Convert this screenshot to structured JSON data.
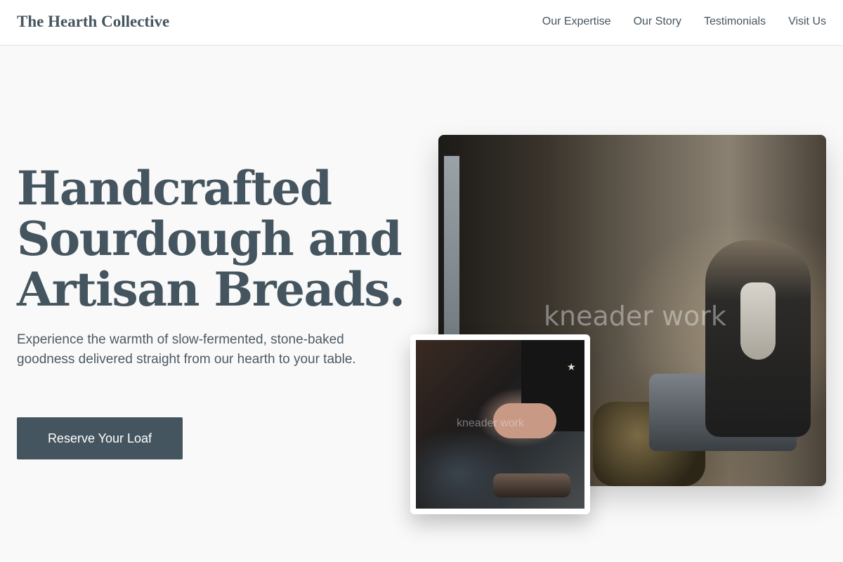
{
  "header": {
    "brand": "The Hearth Collective",
    "nav": [
      "Our Expertise",
      "Our Story",
      "Testimonials",
      "Visit Us"
    ]
  },
  "hero": {
    "headline_lines": [
      "Handcrafted",
      "Sourdough and",
      "Artisan Breads."
    ],
    "subtext": "Experience the warmth of slow-fermented, stone-baked goodness delivered straight from our hearth to your table.",
    "cta_label": "Reserve Your Loaf"
  },
  "images": {
    "main_watermark": "kneader work",
    "small_watermark": "kneader work"
  },
  "colors": {
    "primary": "#45555f",
    "background": "#f9f9f9",
    "header_bg": "#ffffff"
  }
}
